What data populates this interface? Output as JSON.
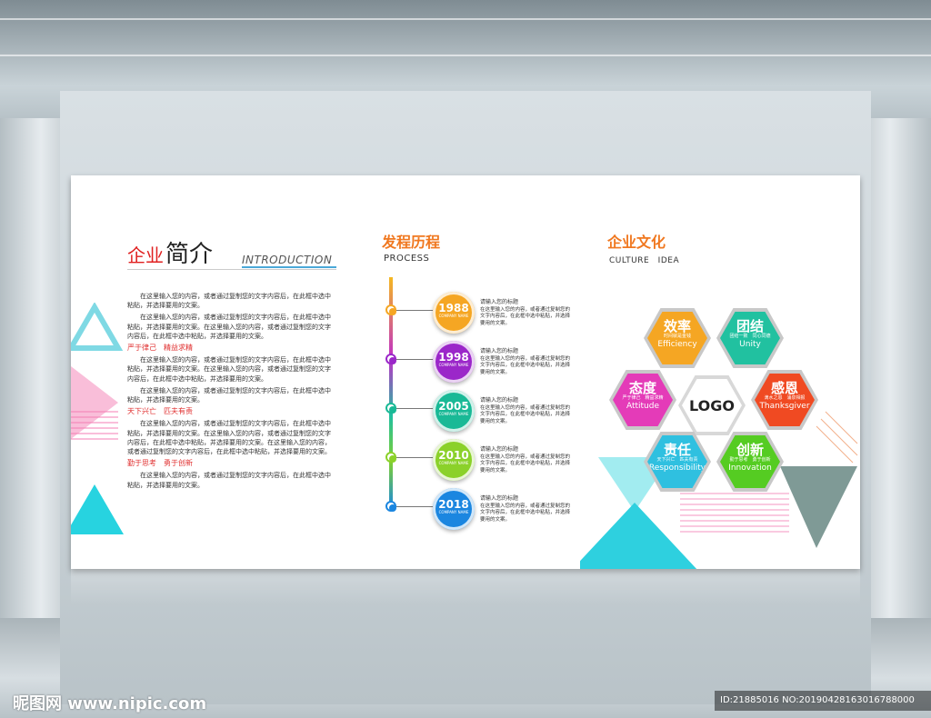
{
  "intro": {
    "title_cn_1": "企业",
    "title_cn_2": "简介",
    "title_en": "INTRODUCTION",
    "paragraphs": [
      "在这里输入您的内容，或者通过复制您的文字内容后，在此框中选中粘贴，并选择要用的文案。",
      "在这里输入您的内容，或者通过复制您的文字内容后，在此框中选中粘贴，并选择要用的文案。在这里输入您的内容，或者通过复制您的文字内容后，在此框中选中粘贴，并选择要用的文案。"
    ],
    "motto_1": "严于律己　精益求精",
    "block_2": [
      "在这里输入您的内容，或者通过复制您的文字内容后，在此框中选中粘贴，并选择要用的文案。在这里输入您的内容，或者通过复制您的文字内容后，在此框中选中粘贴，并选择要用的文案。",
      "在这里输入您的内容，或者通过复制您的文字内容后，在此框中选中粘贴，并选择要用的文案。"
    ],
    "motto_2": "天下兴亡　匹夫有责",
    "block_3": [
      "在这里输入您的内容，或者通过复制您的文字内容后，在此框中选中粘贴，并选择要用的文案。在这里输入您的内容，或者通过复制您的文字内容后，在此框中选中粘贴，并选择要用的文案。在这里输入您的内容，或者通过复制您的文字内容后，在此框中选中粘贴，并选择要用的文案。"
    ],
    "motto_3": "勤于思考　勇于创新",
    "block_4": [
      "在这里输入您的内容，或者通过复制您的文字内容后，在此框中选中粘贴，并选择要用的文案。"
    ]
  },
  "process": {
    "title": "发程历程",
    "subtitle": "PROCESS",
    "items": [
      {
        "year": "1988",
        "company": "COMPANY NAME",
        "heading": "请输入您的标题",
        "text": "在这里输入您的内容，或者通过复制您的文字内容后，在此框中选中粘贴，并选择要用的文案。",
        "color": "#f5a623"
      },
      {
        "year": "1998",
        "company": "COMPANY NAME",
        "heading": "请输入您的标题",
        "text": "在这里输入您的内容，或者通过复制您的文字内容后，在此框中选中粘贴，并选择要用的文案。",
        "color": "#9b27c9"
      },
      {
        "year": "2005",
        "company": "COMPANY NAME",
        "heading": "请输入您的标题",
        "text": "在这里输入您的内容，或者通过复制您的文字内容后，在此框中选中粘贴，并选择要用的文案。",
        "color": "#19b996"
      },
      {
        "year": "2010",
        "company": "COMPANY NAME",
        "heading": "请输入您的标题",
        "text": "在这里输入您的内容，或者通过复制您的文字内容后，在此框中选中粘贴，并选择要用的文案。",
        "color": "#8bd12a"
      },
      {
        "year": "2018",
        "company": "COMPANY NAME",
        "heading": "请输入您的标题",
        "text": "在这里输入您的内容，或者通过复制您的文字内容后，在此框中选中粘贴，并选择要用的文案。",
        "color": "#1b86e0"
      }
    ]
  },
  "culture": {
    "title": "企业文化",
    "subtitle": "CULTURE　IDEA",
    "logo": "LOGO",
    "hexes": [
      {
        "cn": "效率",
        "mid": "时间就是金钱",
        "en": "Efficiency",
        "color": "#f5a623"
      },
      {
        "cn": "团结",
        "mid": "团结一致　同心同德",
        "en": "Unity",
        "color": "#21c1a0"
      },
      {
        "cn": "态度",
        "mid": "严于律己　精益求精",
        "en": "Attitude",
        "color": "#e43bb8"
      },
      {
        "cn": "感恩",
        "mid": "滴水之恩　涌泉相报",
        "en": "Thanksgiver",
        "color": "#f04a22"
      },
      {
        "cn": "责任",
        "mid": "天下兴亡　匹夫有责",
        "en": "Responsibility",
        "color": "#2fc0e0"
      },
      {
        "cn": "创新",
        "mid": "勤于思考　勇于创新",
        "en": "Innovation",
        "color": "#55cc22"
      }
    ]
  },
  "watermark": {
    "left": "昵图网 www.nipic.com",
    "right": "ID:21885016 NO:20190428163016788000"
  }
}
